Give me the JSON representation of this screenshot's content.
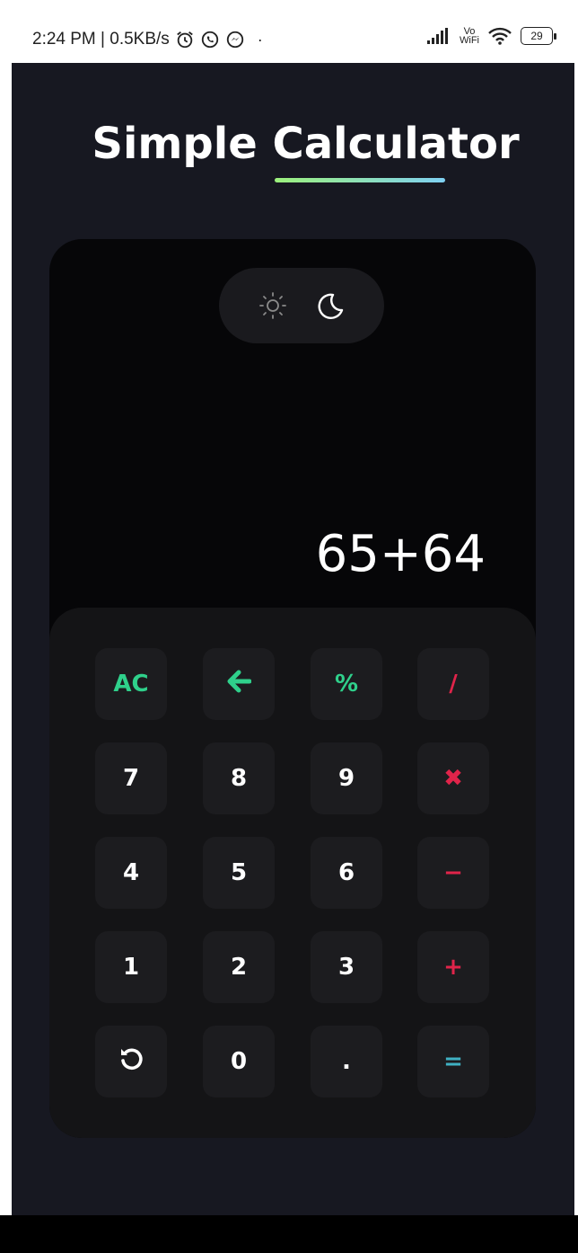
{
  "status_bar": {
    "time_speed": "2:24 PM | 0.5KB/s",
    "vo_top": "Vo",
    "vo_bottom": "WiFi",
    "battery": "29"
  },
  "app": {
    "title": "Simple Calculator",
    "display": "65+64",
    "theme_toggle": {
      "light_icon": "sun-icon",
      "dark_icon": "moon-icon",
      "active": "dark"
    }
  },
  "keypad": {
    "rows": [
      [
        {
          "label": "AC",
          "color": "#2fd08b",
          "name": "clear-button"
        },
        {
          "label": "",
          "icon": "backspace-arrow-icon",
          "color": "#2fd08b",
          "name": "backspace-button"
        },
        {
          "label": "%",
          "color": "#2fd08b",
          "name": "percent-button"
        },
        {
          "label": "/",
          "color": "#e0244a",
          "name": "divide-button"
        }
      ],
      [
        {
          "label": "7",
          "name": "digit-7-button"
        },
        {
          "label": "8",
          "name": "digit-8-button"
        },
        {
          "label": "9",
          "name": "digit-9-button"
        },
        {
          "label": "✖",
          "color": "#e0244a",
          "name": "multiply-button"
        }
      ],
      [
        {
          "label": "4",
          "name": "digit-4-button"
        },
        {
          "label": "5",
          "name": "digit-5-button"
        },
        {
          "label": "6",
          "name": "digit-6-button"
        },
        {
          "label": "−",
          "color": "#e0244a",
          "name": "subtract-button"
        }
      ],
      [
        {
          "label": "1",
          "name": "digit-1-button"
        },
        {
          "label": "2",
          "name": "digit-2-button"
        },
        {
          "label": "3",
          "name": "digit-3-button"
        },
        {
          "label": "+",
          "color": "#e0244a",
          "name": "add-button"
        }
      ],
      [
        {
          "label": "",
          "icon": "undo-icon",
          "name": "undo-button"
        },
        {
          "label": "0",
          "name": "digit-0-button"
        },
        {
          "label": ".",
          "name": "decimal-button"
        },
        {
          "label": "=",
          "color": "#3fb1c3",
          "name": "equals-button"
        }
      ]
    ]
  },
  "colors": {
    "background": "#171821",
    "calc_body": "#060608",
    "keypad": "#141416",
    "key": "#1c1c1f",
    "accent_green": "#2fd08b",
    "accent_red": "#e0244a",
    "accent_teal": "#3fb1c3",
    "underline_start": "#9cf07c",
    "underline_end": "#7fd0f2"
  }
}
